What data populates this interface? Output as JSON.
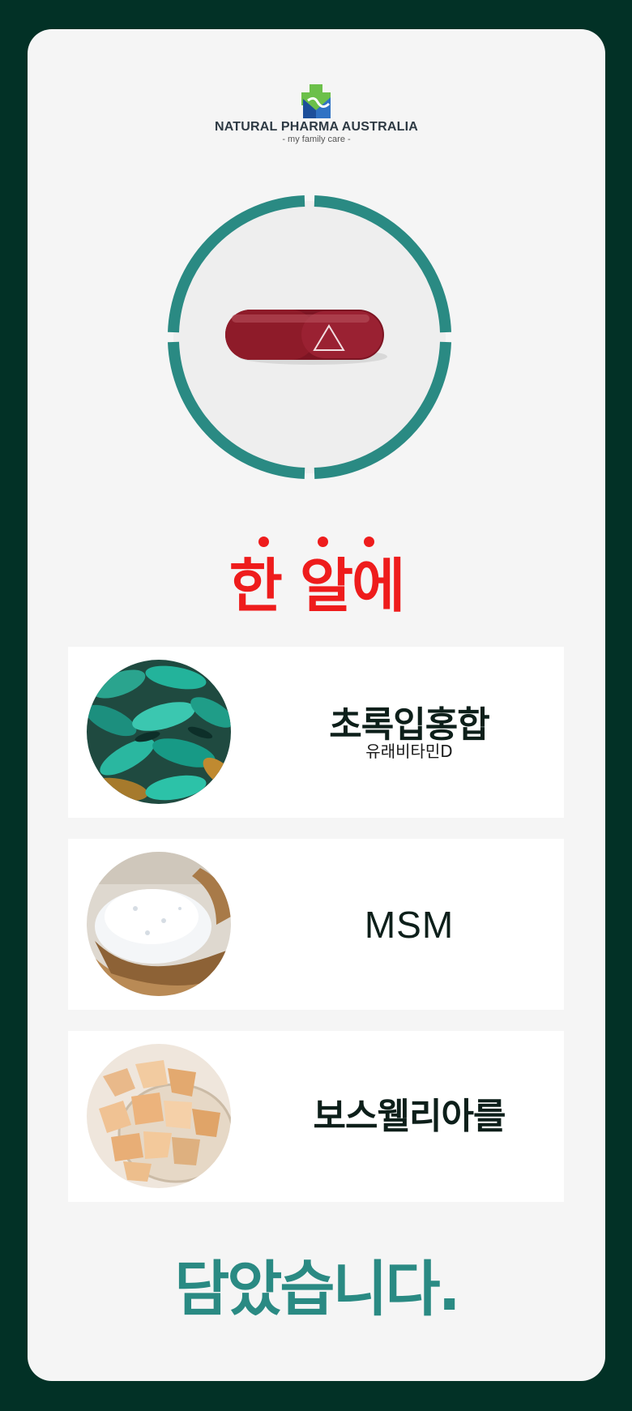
{
  "brand": {
    "name": "NATURAL PHARMA AUSTRALIA",
    "tagline": "- my family care -"
  },
  "colors": {
    "background": "#023126",
    "card": "#f5f5f5",
    "ring": "#2a8a83",
    "headline": "#ee1c1c",
    "footer": "#2a8a83",
    "capsule": "#8e1b29"
  },
  "headline": "한 알에",
  "ingredients": [
    {
      "name": "초록입홍합",
      "sub": "유래비타민D",
      "icon": "green-lipped-mussel-image"
    },
    {
      "name": "MSM",
      "sub": "",
      "icon": "msm-powder-image"
    },
    {
      "name": "보스웰리아를",
      "sub": "",
      "icon": "boswellia-resin-image"
    }
  ],
  "footer": "담았습니다."
}
